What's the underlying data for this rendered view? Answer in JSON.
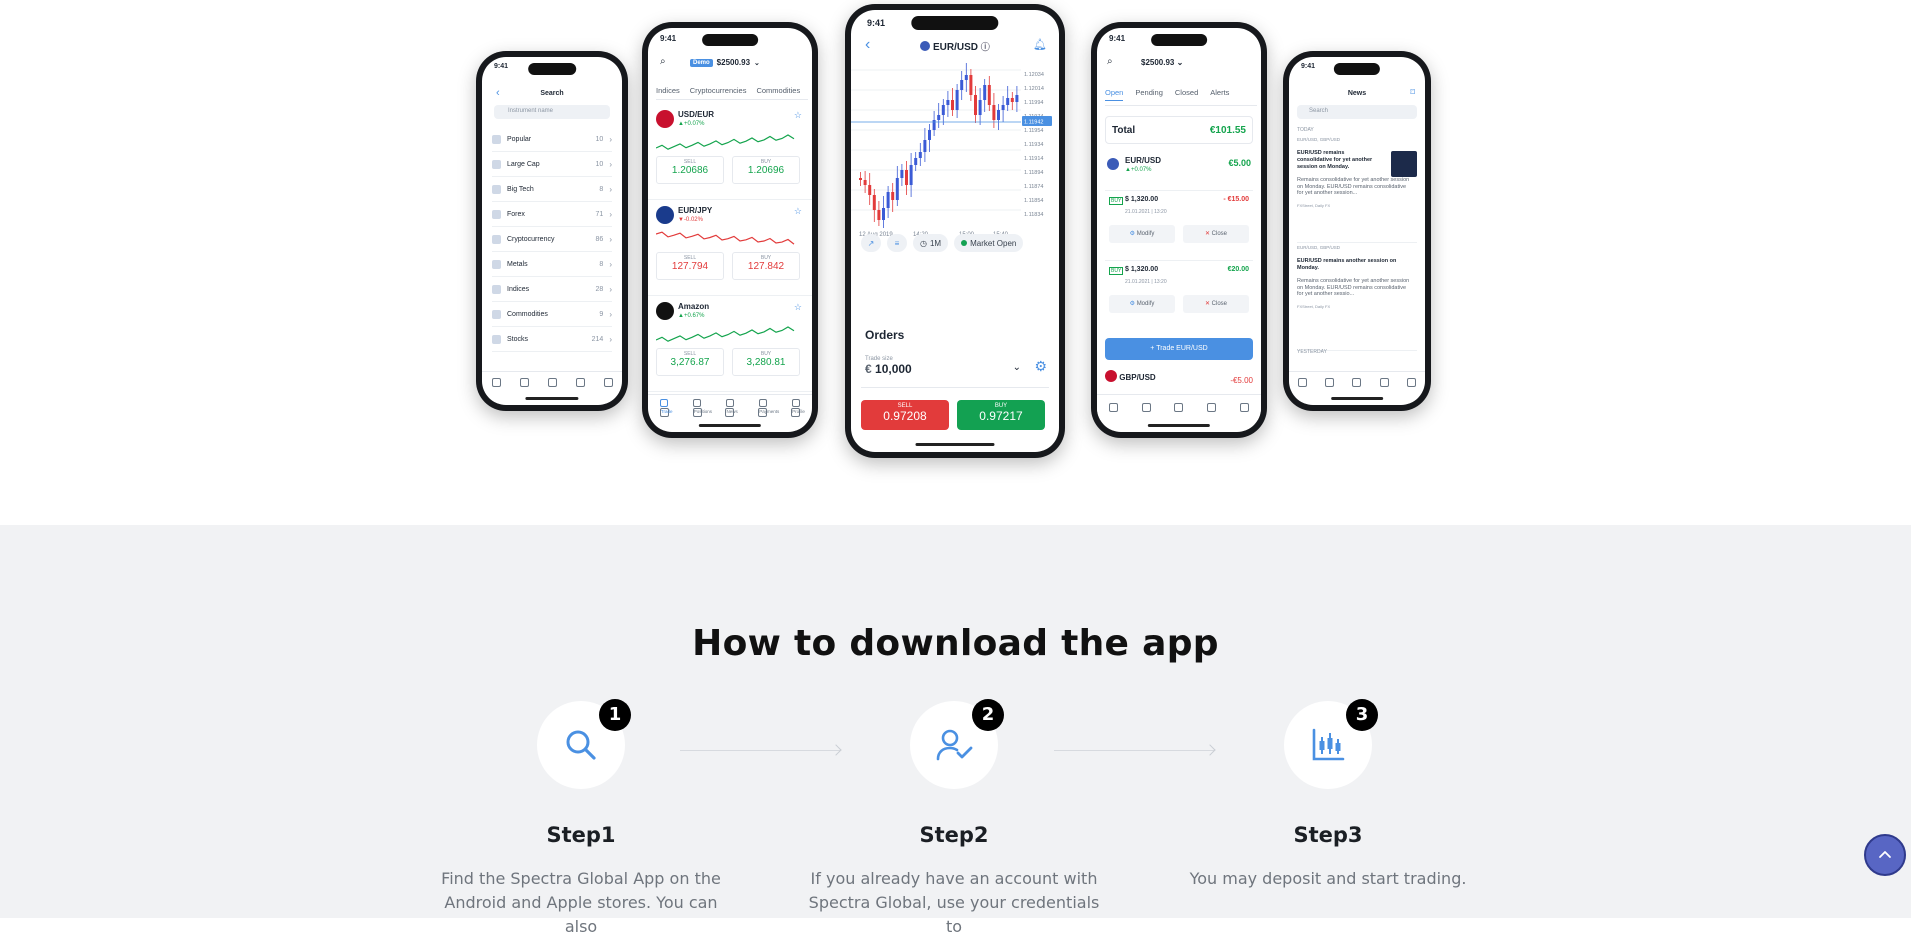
{
  "phones": {
    "search": {
      "time": "9:41",
      "title": "Search",
      "placeholder": "Instrument name",
      "categories": [
        {
          "label": "Popular",
          "count": "10"
        },
        {
          "label": "Large Cap",
          "count": "10"
        },
        {
          "label": "Big Tech",
          "count": "8"
        },
        {
          "label": "Forex",
          "count": "71"
        },
        {
          "label": "Cryptocurrency",
          "count": "86"
        },
        {
          "label": "Metals",
          "count": "8"
        },
        {
          "label": "Indices",
          "count": "28"
        },
        {
          "label": "Commodities",
          "count": "9"
        },
        {
          "label": "Stocks",
          "count": "214"
        }
      ]
    },
    "markets": {
      "time": "9:41",
      "badge": "Demo",
      "balance": "$2500.93",
      "tabs": [
        "Indices",
        "Cryptocurrencies",
        "Commodities"
      ],
      "instruments": [
        {
          "name": "USD/EUR",
          "change": "▲+0.07%",
          "sell_label": "SELL",
          "sell": "1.20686",
          "buy_label": "BUY",
          "buy": "1.20696"
        },
        {
          "name": "EUR/JPY",
          "change": "▼-0.02%",
          "sell_label": "SELL",
          "sell": "127.794",
          "buy_label": "BUY",
          "buy": "127.842"
        },
        {
          "name": "Amazon",
          "change": "▲+0.67%",
          "sell_label": "SELL",
          "sell": "3,276.87",
          "buy_label": "BUY",
          "buy": "3,280.81"
        }
      ],
      "nav": [
        "Trade",
        "Positions",
        "News",
        "Payments",
        "Profile"
      ]
    },
    "chart": {
      "time": "9:41",
      "pair": "EUR/USD",
      "price_ticks": [
        "1.12034",
        "1.12014",
        "1.11994",
        "1.11974",
        "1.11954",
        "1.11934",
        "1.11914",
        "1.11894",
        "1.11874",
        "1.11854",
        "1.11834"
      ],
      "current_price": "1.11942",
      "time_ticks": [
        "12 Aug 2019",
        "14:20",
        "15:00",
        "15:40"
      ],
      "timeframe": "1M",
      "market_status": "Market Open",
      "orders_title": "Orders",
      "trade_size_label": "Trade size",
      "currency": "€",
      "trade_size": "10,000",
      "sell_label": "SELL",
      "sell_price": "0.97208",
      "buy_label": "BUY",
      "buy_price": "0.97217"
    },
    "positions": {
      "time": "9:41",
      "balance": "$2500.93",
      "tabs": [
        "Open",
        "Pending",
        "Closed",
        "Alerts"
      ],
      "total_label": "Total",
      "total_value": "€101.55",
      "pair": "EUR/USD",
      "pair_change": "▲+0.07%",
      "pair_value": "€5.00",
      "trades": [
        {
          "side": "BUY",
          "amount": "$ 1,320.00",
          "pnl": "- €15.00",
          "date": "21.01.2021 | 13:20"
        },
        {
          "side": "BUY",
          "amount": "$ 1,320.00",
          "pnl": "€20.00",
          "date": "21.01.2021 | 13:20"
        }
      ],
      "modify_label": "Modify",
      "close_label": "Close",
      "trade_button": "+ Trade EUR/USD",
      "second_pair": "GBP/USD",
      "second_value": "-€5.00"
    },
    "news": {
      "time": "9:41",
      "title": "News",
      "search_placeholder": "Search",
      "section_today": "TODAY",
      "items": [
        {
          "tags": "EUR/USD, GBP/USD",
          "headline": "EUR/USD remains consolidative for yet another session on Monday.",
          "body": "Remains consolidative for yet another session on Monday. EUR/USD remains consolidative for yet another session...",
          "meta": "FXStreet, Daily FX"
        },
        {
          "tags": "EUR/USD, GBP/USD",
          "headline": "EUR/USD remains another session on Monday.",
          "body": "Remains consolidative for yet another session on Monday. EUR/USD remains consolidative for yet another sessio...",
          "meta": "FXStreet, Daily FX"
        }
      ],
      "section_yesterday": "YESTERDAY"
    }
  },
  "download": {
    "title": "How to download the app",
    "steps": [
      {
        "number": "1",
        "icon": "search-icon",
        "title": "Step1",
        "desc_lines": [
          "Find the Spectra Global App on the",
          "Android and Apple stores. You can also"
        ]
      },
      {
        "number": "2",
        "icon": "user-check-icon",
        "title": "Step2",
        "desc_lines": [
          "If you already have an account with",
          "Spectra Global, use your credentials to"
        ]
      },
      {
        "number": "3",
        "icon": "candlestick-chart-icon",
        "title": "Step3",
        "desc_lines": [
          "You may deposit and start trading."
        ]
      }
    ]
  },
  "colors": {
    "accent": "#4a90e2",
    "sell": "#e23b3b",
    "buy": "#13a152",
    "section_bg": "#f1f2f4",
    "to_top": "#5866c4"
  }
}
